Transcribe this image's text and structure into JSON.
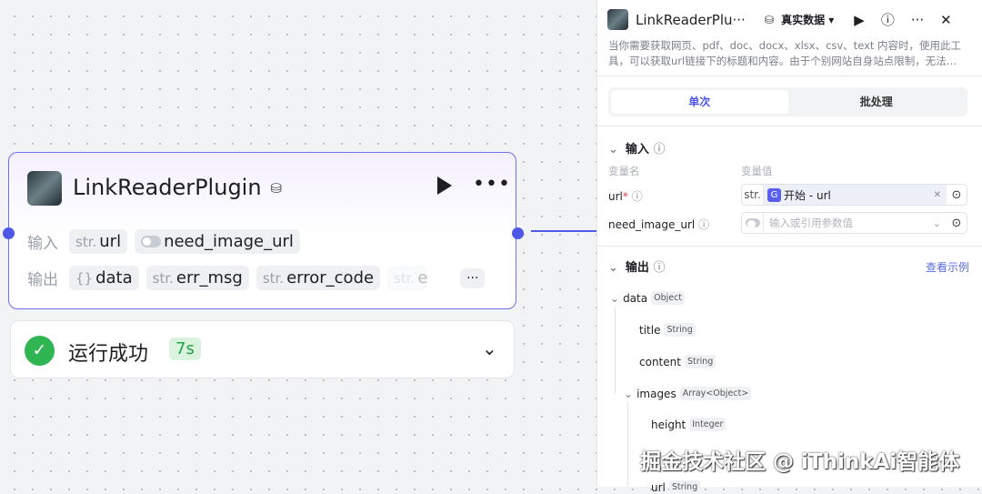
{
  "node": {
    "title": "LinkReaderPlugin",
    "input_label": "输入",
    "output_label": "输出",
    "inputs": [
      {
        "type": "str.",
        "name": "url"
      },
      {
        "type": "toggle",
        "name": "need_image_url"
      }
    ],
    "outputs": [
      {
        "type": "{}",
        "name": "data"
      },
      {
        "type": "str.",
        "name": "err_msg"
      },
      {
        "type": "str.",
        "name": "error_code"
      },
      {
        "type": "str.",
        "name": "er"
      }
    ],
    "more": "···"
  },
  "status": {
    "text": "运行成功",
    "time": "7s"
  },
  "panel": {
    "title": "LinkReaderPlu···",
    "data_mode": "真实数据 ▾",
    "description": "当你需要获取网页、pdf、doc、docx、xlsx、csv、text 内容时，使用此工具，可以获取url链接下的标题和内容。由于个别网站自身站点限制，无法…",
    "tabs": [
      "单次",
      "批处理"
    ],
    "input_section": "输入",
    "col_name": "变量名",
    "col_value": "变量值",
    "fields": [
      {
        "name": "url",
        "required": "*",
        "prefix": "str.",
        "ref": "开始 - url"
      },
      {
        "name": "need_image_url",
        "placeholder": "输入或引用参数值"
      }
    ],
    "output_section": "输出",
    "view_example": "查看示例",
    "tree": [
      {
        "name": "data",
        "type": "Object"
      },
      {
        "name": "title",
        "type": "String"
      },
      {
        "name": "content",
        "type": "String"
      },
      {
        "name": "images",
        "type": "Array<Object>"
      },
      {
        "name": "height",
        "type": "Integer"
      },
      {
        "name": "url",
        "type": "String"
      }
    ]
  },
  "watermark": "掘金技术社区 @ iThinkAi智能体"
}
